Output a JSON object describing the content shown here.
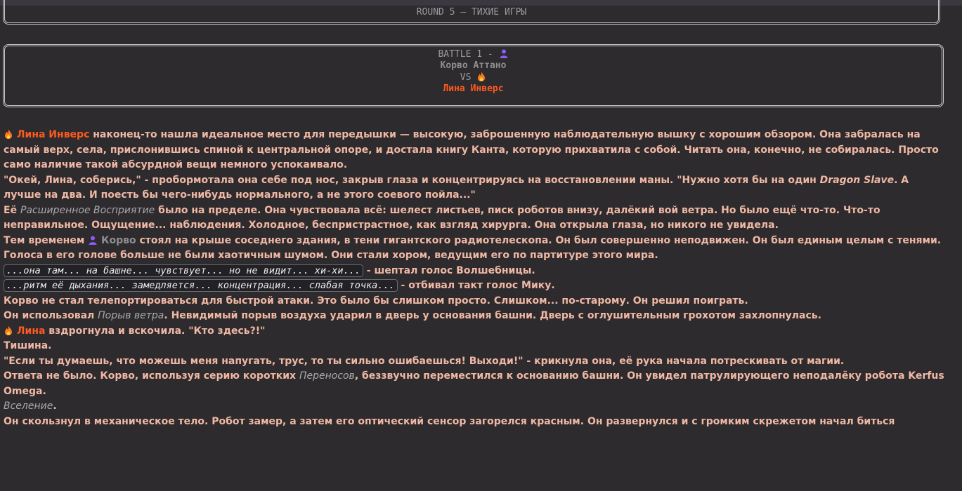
{
  "round": {
    "title": "ROUND 5 – ТИХИЕ ИГРЫ"
  },
  "battle": {
    "label": "BATTLE 1 -",
    "fighter1": "Корво Аттано",
    "vs": "VS",
    "fighter2": "Лина Инверс"
  },
  "story": {
    "p1": {
      "name": "Лина Инверс",
      "text": " наконец-то нашла идеальное место для передышки — высокую, заброшенную наблюдательную вышку с хорошим обзором. Она забралась на самый верх, села, прислонившись спиной к центральной опоре, и достала книгу Канта, которую прихватила с собой. Читать она, конечно, не собиралась. Просто само наличие такой абсурдной вещи немного успокаивало."
    },
    "p2": {
      "a": "\"Окей, Лина, соберись,\" - пробормотала она себе под нос, закрыв глаза и концентрируясь на восстановлении маны. \"Нужно хотя бы на один ",
      "em": "Dragon Slave",
      "b": ". А лучше на два. И поесть бы чего-нибудь нормального, а не этого соевого пойла...\""
    },
    "p3": {
      "a": "Её ",
      "em": "Расширенное Восприятие",
      "b": " было на пределе. Она чувствовала всё: шелест листьев, писк роботов внизу, далёкий вой ветра. Но было ещё что-то. Что-то неправильное. Ощущение... наблюдения. Холодное, беспристрастное, как взгляд хирурга. Она открыла глаза, но никого не увидела."
    },
    "p4": {
      "a": "Тем временем ",
      "name": "Корво",
      "b": " стоял на крыше соседнего здания, в тени гигантского радиотелескопа. Он был совершенно неподвижен. Он был единым целым с тенями. Голоса в его голове больше не были хаотичным шумом. Они стали хором, ведущим его по партитуре этого мира."
    },
    "p5": {
      "code": "...она там... на башне... чувствует... но не видит... хи-хи...",
      "b": " - шептал голос Волшебницы."
    },
    "p6": {
      "code": "...ритм её дыхания... замедляется... концентрация... слабая точка...",
      "b": " - отбивал такт голос Мику."
    },
    "p7": "Корво не стал телепортироваться для быстрой атаки. Это было бы слишком просто. Слишком... по-старому. Он решил поиграть.",
    "p8": {
      "a": "Он использовал ",
      "em": "Порыв ветра",
      "b": ". Невидимый порыв воздуха ударил в дверь у основания башни. Дверь с оглушительным грохотом захлопнулась."
    },
    "p9": {
      "name": "Лина",
      "b": " вздрогнула и вскочила. \"Кто здесь?!\""
    },
    "p10": "Тишина.",
    "p11": "\"Если ты думаешь, что можешь меня напугать, трус, то ты сильно ошибаешься! Выходи!\" - крикнула она, её рука начала потрескивать от магии.",
    "p12": {
      "a": "Ответа не было. Корво, используя серию коротких ",
      "em": "Переносов",
      "b": ", беззвучно переместился к основанию башни. Он увидел патрулирующего неподалёку робота Kerfus Omega."
    },
    "p13": {
      "em": "Вселение",
      "b": "."
    },
    "p14": "Он скользнул в механическое тело. Робот замер, а затем его оптический сенсор загорелся красным. Он развернулся и с громким скрежетом начал биться"
  },
  "icons": {
    "lina": "fire-icon",
    "corvo": "person-icon"
  },
  "colors": {
    "lina": "#ff5a1f",
    "corvo": "#8e8e92",
    "text": "#f0b8a4",
    "background": "#2d2b2e"
  }
}
